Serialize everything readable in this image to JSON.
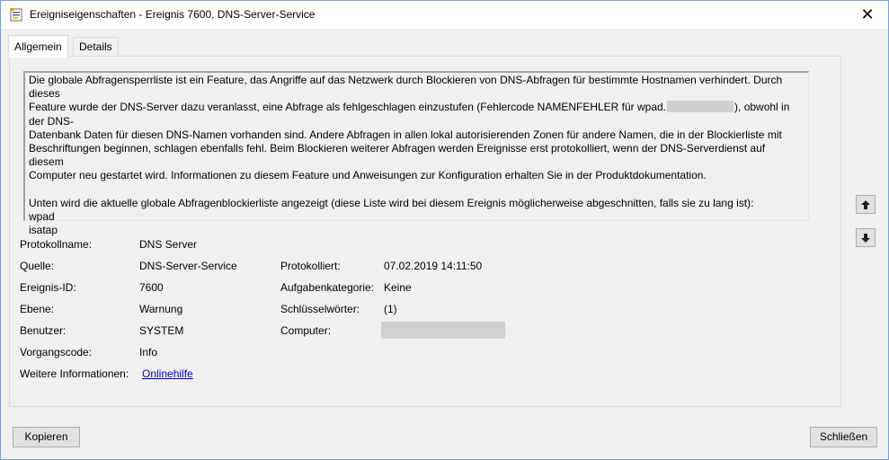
{
  "window": {
    "title": "Ereigniseigenschaften - Ereignis 7600, DNS-Server-Service",
    "close_glyph": "✕",
    "app_icon": "event-viewer-icon"
  },
  "tabs": [
    {
      "label": "Allgemein",
      "active": true
    },
    {
      "label": "Details",
      "active": false
    }
  ],
  "description": {
    "line1": "Die globale Abfragensperrliste ist ein Feature, das Angriffe auf das Netzwerk durch Blockieren von DNS-Abfragen für bestimmte Hostnamen verhindert. Durch dieses",
    "line2_a": "Feature wurde der DNS-Server dazu veranlasst, eine Abfrage als fehlgeschlagen einzustufen (Fehlercode NAMENFEHLER für wpad.",
    "line2_b": "), obwohl in der DNS-",
    "line3": "Datenbank Daten für diesen DNS-Namen vorhanden sind. Andere Abfragen in allen lokal autorisierenden Zonen für andere Namen, die in der Blockierliste mit",
    "line4": "Beschriftungen beginnen, schlagen ebenfalls fehl. Beim Blockieren weiterer Abfragen werden Ereignisse erst protokolliert, wenn der DNS-Serverdienst auf diesem",
    "line5": "Computer neu gestartet wird. Informationen zu diesem Feature und Anweisungen zur Konfiguration erhalten Sie in der Produktdokumentation.",
    "line6": "Unten wird die aktuelle globale Abfragenblockierliste angezeigt (diese Liste wird bei diesem Ereignis möglicherweise abgeschnitten, falls sie zu lang ist):",
    "list": [
      "wpad",
      "isatap"
    ]
  },
  "fields": {
    "protokollname": {
      "label": "Protokollname:",
      "value": "DNS Server"
    },
    "quelle": {
      "label": "Quelle:",
      "value": "DNS-Server-Service"
    },
    "ereignis_id": {
      "label": "Ereignis-ID:",
      "value": "7600"
    },
    "ebene": {
      "label": "Ebene:",
      "value": "Warnung"
    },
    "benutzer": {
      "label": "Benutzer:",
      "value": "SYSTEM"
    },
    "vorgangscode": {
      "label": "Vorgangscode:",
      "value": "Info"
    },
    "weitere": {
      "label": "Weitere Informationen:",
      "value": "Onlinehilfe"
    },
    "protokolliert": {
      "label": "Protokolliert:",
      "value": "07.02.2019 14:11:50"
    },
    "aufgabenkategorie": {
      "label": "Aufgabenkategorie:",
      "value": "Keine"
    },
    "schluesselwoerter": {
      "label": "Schlüsselwörter:",
      "value": "(1)"
    },
    "computer": {
      "label": "Computer:",
      "value": ""
    }
  },
  "buttons": {
    "copy": "Kopieren",
    "close": "Schließen",
    "up_icon": "arrow-up-icon",
    "down_icon": "arrow-down-icon"
  },
  "colors": {
    "link": "#0000cc",
    "window_border": "#7a9fd1",
    "background": "#f0f0f0"
  }
}
